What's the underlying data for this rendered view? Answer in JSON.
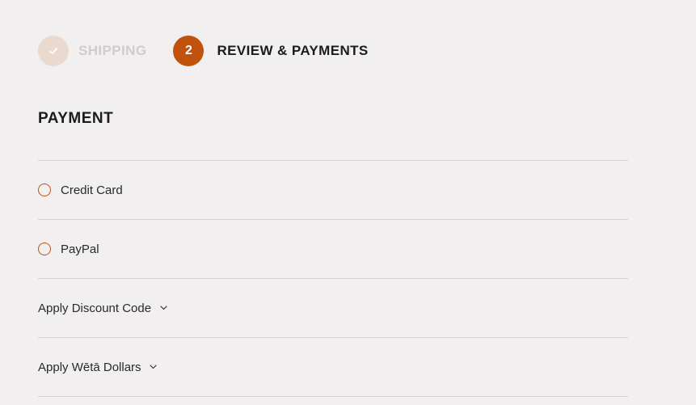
{
  "progress": {
    "steps": [
      {
        "label": "Shipping",
        "state": "complete",
        "icon": "check-icon"
      },
      {
        "label": "Review & Payments",
        "number": "2",
        "state": "active"
      }
    ]
  },
  "payment": {
    "title": "PAYMENT",
    "methods": [
      {
        "label": "Credit Card",
        "selected": false
      },
      {
        "label": "PayPal",
        "selected": false
      }
    ],
    "collapsibles": [
      {
        "label": "Apply Discount Code",
        "icon": "chevron-down-icon"
      },
      {
        "label": "Apply Wētā Dollars",
        "icon": "chevron-down-icon"
      }
    ]
  },
  "colors": {
    "background": "#f1eff0",
    "accent": "#c1520e",
    "completed_step": "#ead9cf",
    "divider": "#d3d0d1"
  }
}
